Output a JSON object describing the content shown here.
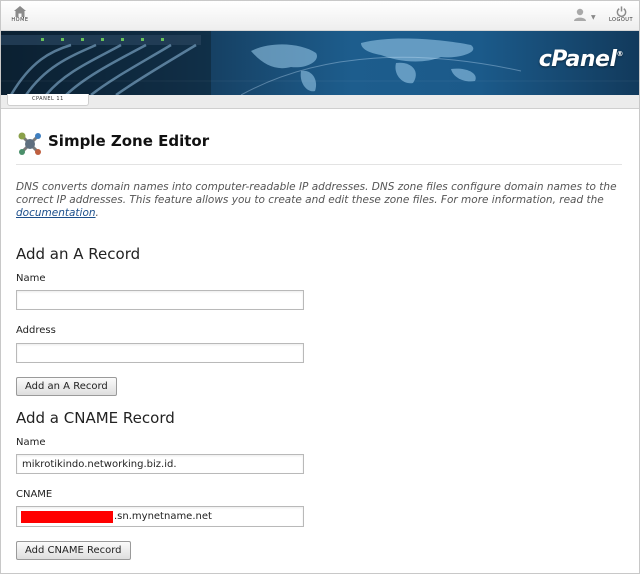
{
  "topbar": {
    "home_label": "HOME",
    "logout_label": "LOGOUT"
  },
  "banner": {
    "logo_text": "cPanel"
  },
  "breadcrumb": {
    "label": "CPANEL 11"
  },
  "page": {
    "title": "Simple Zone Editor",
    "description": "DNS converts domain names into computer-readable IP addresses. DNS zone files configure domain names to the correct IP addresses. This feature allows you to create and edit these zone files. For more information, read the ",
    "doc_link": "documentation",
    "desc_end": "."
  },
  "a_record": {
    "heading": "Add an A Record",
    "name_label": "Name",
    "name_value": "",
    "address_label": "Address",
    "address_value": "",
    "button": "Add an A Record"
  },
  "cname_record": {
    "heading": "Add a CNAME Record",
    "name_label": "Name",
    "name_value": "mikrotikindo.networking.biz.id.",
    "cname_label": "CNAME",
    "cname_value_visible": ".sn.mynetname.net",
    "button": "Add CNAME Record"
  },
  "colors": {
    "banner_blue": "#1d5d8d",
    "link": "#1c4f8c",
    "redaction": "#ff0000"
  },
  "icons": {
    "home": "home-icon",
    "user": "user-icon",
    "logout": "power-icon",
    "title": "zone-editor-icon"
  }
}
